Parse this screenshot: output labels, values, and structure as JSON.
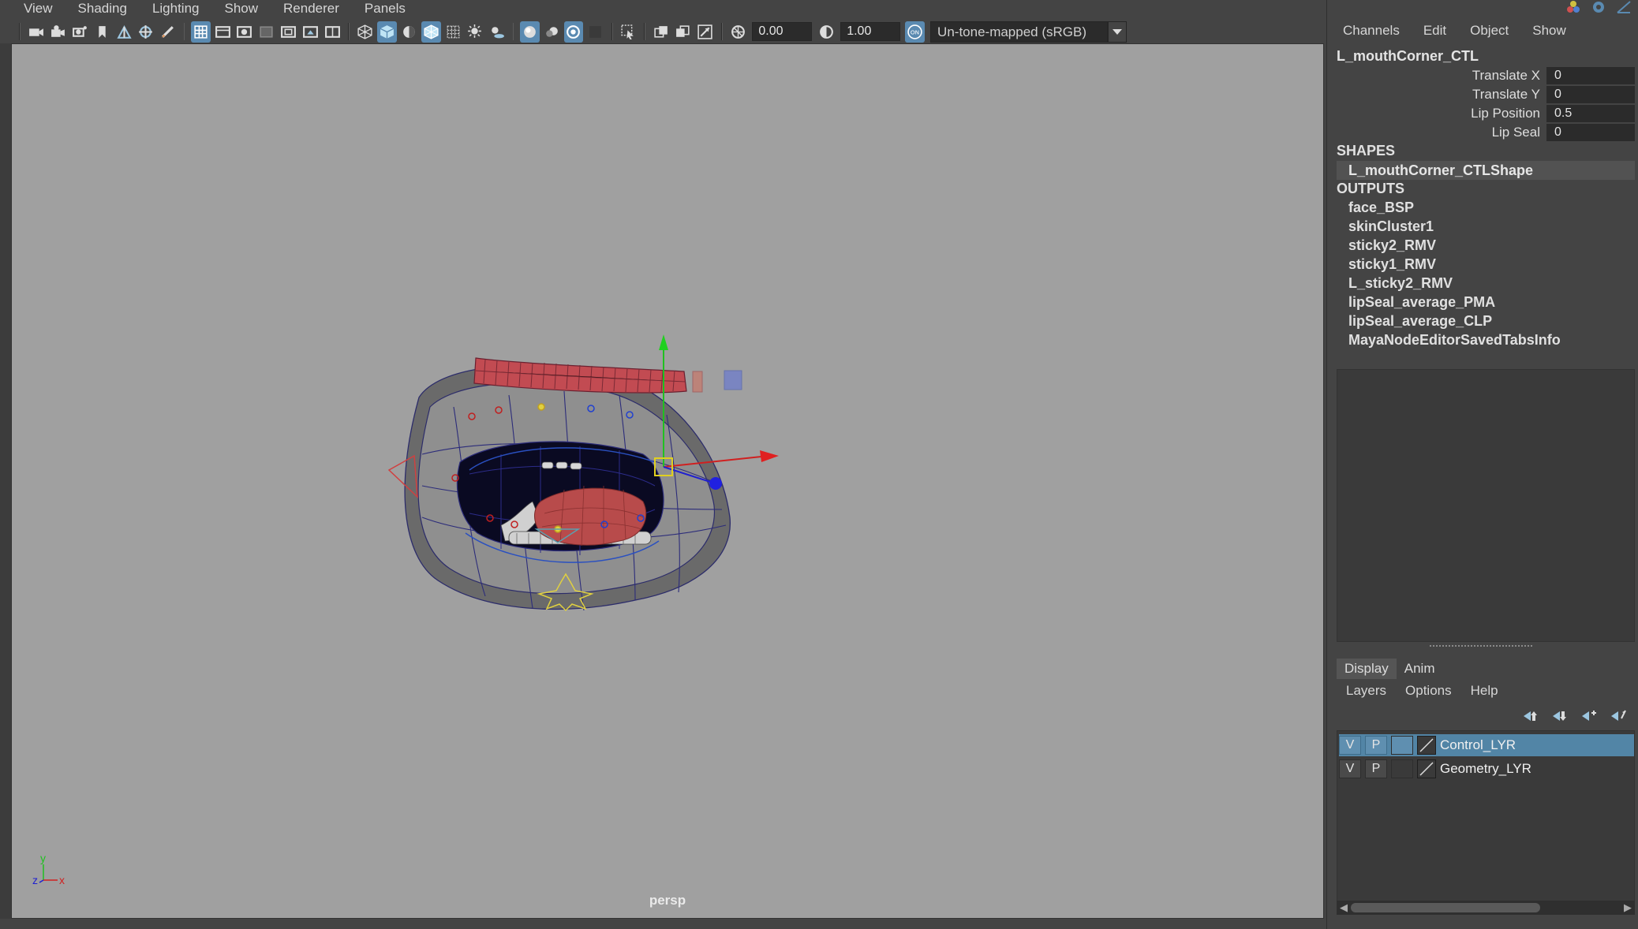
{
  "viewport_menu": [
    "View",
    "Shading",
    "Lighting",
    "Show",
    "Renderer",
    "Panels"
  ],
  "toolbar": {
    "exposure": "0.00",
    "gamma": "1.00",
    "color_space": "Un-tone-mapped (sRGB)",
    "icons": [
      "select-camera-icon",
      "camera-attributes-icon",
      "bookmark-icon",
      "image-plane-icon",
      "2d-pan-zoom-icon",
      "grease-pencil-icon",
      "grid-icon",
      "film-gate-icon",
      "resolution-gate-icon",
      "gate-mask-icon",
      "field-chart-icon",
      "safe-action-icon",
      "safe-title-icon",
      "wireframe-icon",
      "smooth-shade-icon",
      "default-material-icon",
      "wireframe-on-shaded-icon",
      "xray-icon",
      "use-lights-icon",
      "shadows-icon",
      "screen-space-ao-icon",
      "motion-blur-icon",
      "antialiasing-icon",
      "depth-of-field-icon",
      "isolate-select-icon",
      "xray-joints-icon",
      "xray-active-icon",
      "exposure-icon",
      "gamma-icon",
      "color-management-icon"
    ]
  },
  "viewport": {
    "camera": "persp",
    "axis": {
      "y": "y",
      "z": "z",
      "x": "x"
    }
  },
  "channel_box": {
    "menu": [
      "Channels",
      "Edit",
      "Object",
      "Show"
    ],
    "node": "L_mouthCorner_CTL",
    "attributes": [
      {
        "label": "Translate X",
        "value": "0"
      },
      {
        "label": "Translate Y",
        "value": "0"
      },
      {
        "label": "Lip Position",
        "value": "0.5"
      },
      {
        "label": "Lip Seal",
        "value": "0"
      }
    ],
    "shapes_heading": "SHAPES",
    "shapes": [
      "L_mouthCorner_CTLShape"
    ],
    "outputs_heading": "OUTPUTS",
    "outputs": [
      "face_BSP",
      "skinCluster1",
      "sticky2_RMV",
      "sticky1_RMV",
      "L_sticky2_RMV",
      "lipSeal_average_PMA",
      "lipSeal_average_CLP",
      "MayaNodeEditorSavedTabsInfo"
    ]
  },
  "layer_editor": {
    "tabs": [
      "Display",
      "Anim"
    ],
    "active_tab": "Display",
    "menu": [
      "Layers",
      "Options",
      "Help"
    ],
    "layers": [
      {
        "v": "V",
        "p": "P",
        "name": "Control_LYR",
        "selected": true
      },
      {
        "v": "V",
        "p": "P",
        "name": "Geometry_LYR",
        "selected": false
      }
    ]
  },
  "colors": {
    "viewport_bg": "#a0a0a0",
    "panel_bg": "#444444",
    "selection": "#5285a6",
    "active_icon": "#5a8ab1"
  }
}
